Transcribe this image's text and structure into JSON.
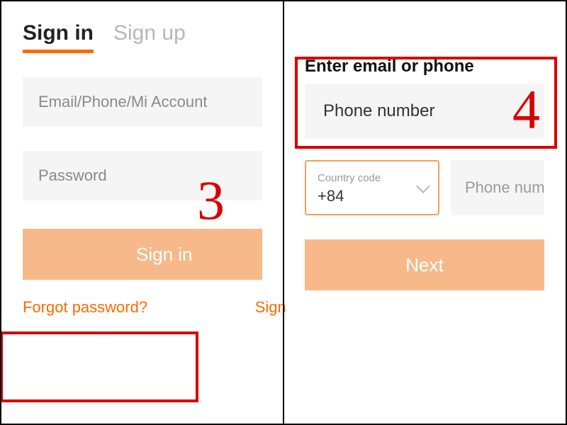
{
  "left": {
    "tabs": {
      "signin": "Sign in",
      "signup": "Sign up"
    },
    "fields": {
      "identity_placeholder": "Email/Phone/Mi Account",
      "password_placeholder": "Password"
    },
    "button": "Sign in",
    "links": {
      "forgot": "Forgot password?",
      "signup": "Sign"
    },
    "annotation_number": "3"
  },
  "right": {
    "title": "Enter email or phone",
    "option_label": "Phone number",
    "country": {
      "label": "Country code",
      "value": "+84"
    },
    "phone_placeholder": "Phone num",
    "button": "Next",
    "annotation_number": "4"
  }
}
